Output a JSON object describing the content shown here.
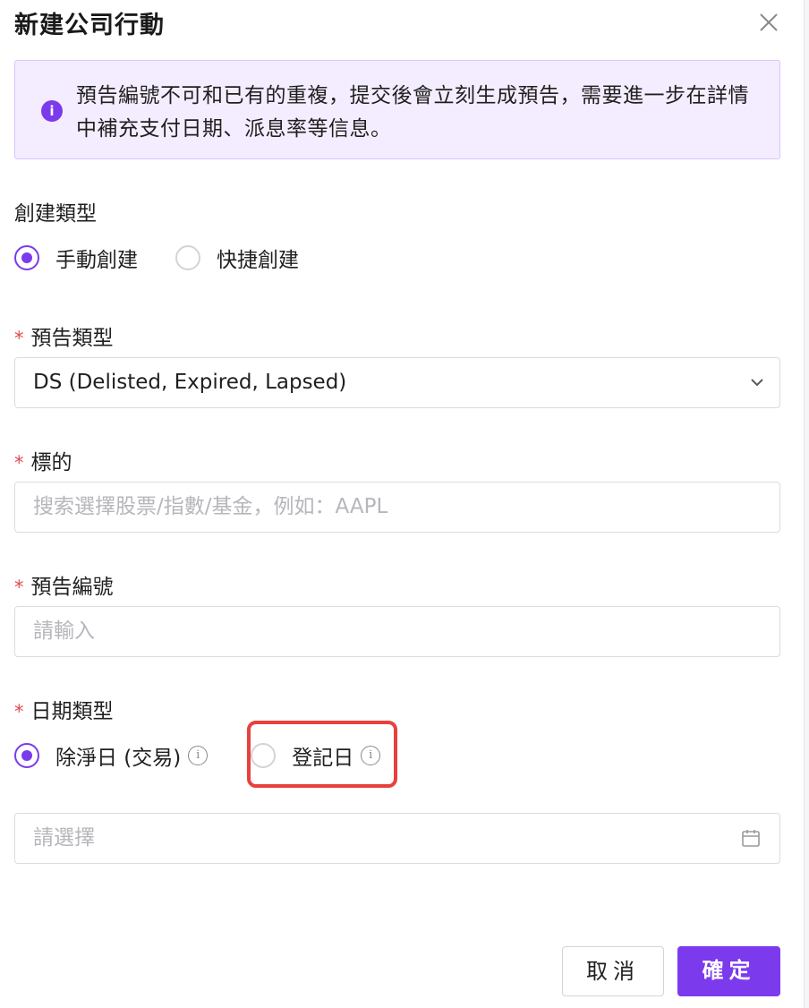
{
  "dialog": {
    "title": "新建公司行動"
  },
  "notice": {
    "icon": "info-icon",
    "text": "預告編號不可和已有的重複，提交後會立刻生成預告，需要進一步在詳情中補充支付日期、派息率等信息。"
  },
  "create_type": {
    "label": "創建類型",
    "options": [
      "手動創建",
      "快捷創建"
    ],
    "selected": "手動創建"
  },
  "notice_type": {
    "required_mark": "*",
    "label": "預告類型",
    "value": "DS (Delisted, Expired, Lapsed)"
  },
  "target": {
    "required_mark": "*",
    "label": "標的",
    "placeholder": "搜索選擇股票/指數/基金，例如：AAPL"
  },
  "notice_no": {
    "required_mark": "*",
    "label": "預告編號",
    "placeholder": "請輸入"
  },
  "date_type": {
    "required_mark": "*",
    "label": "日期類型",
    "options": [
      "除淨日 (交易)",
      "登記日"
    ],
    "selected": "除淨日 (交易)"
  },
  "date_picker": {
    "placeholder": "請選擇"
  },
  "footer": {
    "cancel_label": "取消",
    "ok_label": "確定"
  },
  "colors": {
    "accent": "#7c3aed",
    "notice_bg": "#f4edff",
    "required": "#e5484d",
    "highlight": "#e8403c"
  }
}
